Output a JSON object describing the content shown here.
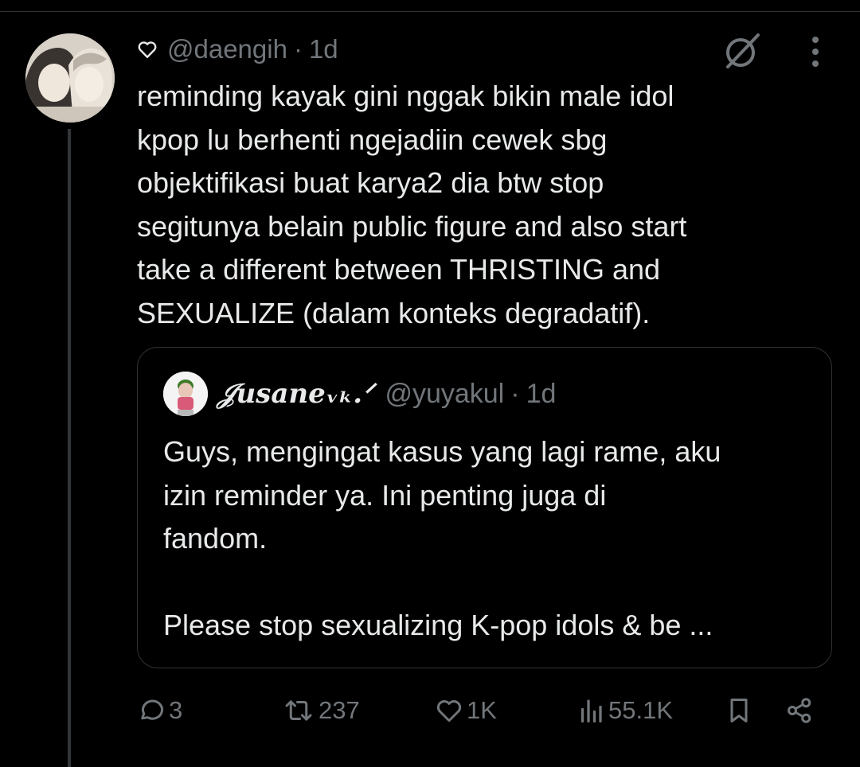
{
  "tweet": {
    "author": {
      "handle": "@daengih",
      "timestamp": "1d",
      "separator": "·",
      "heart_icon": "heart-outline-icon",
      "avatar": "avatar-photo"
    },
    "text": "reminding kayak gini nggak bikin male idol\nkpop lu berhenti ngejadiin cewek sbg\nobjektifikasi buat karya2 dia btw stop\nsegitunya belain public figure and also start\ntake a different between THRISTING and\nSEXUALIZE (dalam konteks degradatif).",
    "header_icons": [
      "grok-icon",
      "more-options-icon"
    ]
  },
  "quote": {
    "author": {
      "display_name": "𝒥usaneᵥₖ.ᐟ",
      "handle": "@yuyakul",
      "separator": "·",
      "timestamp": "1d"
    },
    "text": "Guys, mengingat kasus yang lagi rame, aku\nizin reminder ya. Ini penting juga di\nfandom.\n\nPlease stop sexualizing K-pop idols & be ..."
  },
  "actions": {
    "reply": {
      "icon": "reply-icon",
      "count": "3"
    },
    "repost": {
      "icon": "repost-icon",
      "count": "237"
    },
    "like": {
      "icon": "like-icon",
      "count": "1K"
    },
    "views": {
      "icon": "views-icon",
      "count": "55.1K"
    },
    "bookmark": {
      "icon": "bookmark-icon"
    },
    "share": {
      "icon": "share-icon"
    }
  },
  "colors": {
    "background": "#000000",
    "text_primary": "#e7e9ea",
    "text_secondary": "#71767b",
    "border": "#2f3336"
  }
}
